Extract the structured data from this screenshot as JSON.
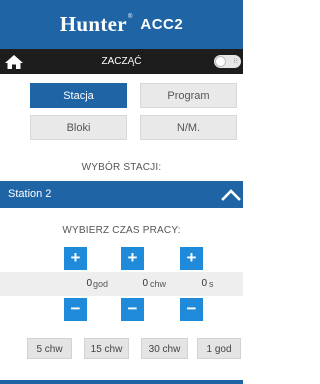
{
  "header": {
    "brand": "Hunter",
    "brand_mark": "®",
    "model": "ACC2"
  },
  "topbar": {
    "home_icon": "home-icon",
    "title": "ZACZĄĆ",
    "toggle_icon": "toggle-switch",
    "toggle_state": "off"
  },
  "tabs": [
    {
      "label": "Stacja",
      "active": true
    },
    {
      "label": "Program",
      "active": false
    },
    {
      "label": "Bloki",
      "active": false
    },
    {
      "label": "N/M.",
      "active": false
    }
  ],
  "station_section": {
    "title": "WYBÓR STACJI:",
    "selected": "Station 2",
    "collapse_icon": "chevron-up-icon"
  },
  "runtime": {
    "title": "WYBIERZ CZAS PRACY:",
    "plus_label": "+",
    "minus_label": "−",
    "hours": {
      "value": "0",
      "unit": "god"
    },
    "minutes": {
      "value": "0",
      "unit": "chw"
    },
    "seconds": {
      "value": "0",
      "unit": "s"
    }
  },
  "presets": [
    "5 chw",
    "15 chw",
    "30 chw",
    "1 god"
  ],
  "colors": {
    "brand_blue": "#1f65a6",
    "button_blue": "#1f8ad9",
    "topbar_dark": "#1d1d1d"
  }
}
